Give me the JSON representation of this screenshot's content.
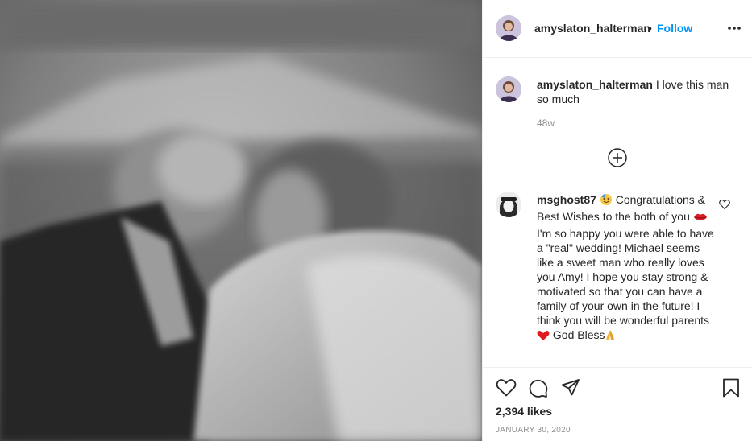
{
  "post": {
    "author": "amyslaton_halterman",
    "follow_label": "Follow",
    "separator": "•",
    "caption": {
      "username": "amyslaton_halterman",
      "text": "I love this man so much",
      "time": "48w"
    },
    "comment": {
      "username": "msghost87",
      "part1": "Congratulations & Best Wishes to the both of you",
      "part2": "I'm so happy you were able to have a \"real\" wedding! Michael seems like a sweet man who really loves you Amy! I hope you stay strong & motivated so that you can have a family of your own in the future! I think you will be wonderful parents",
      "part3": "God Bless"
    },
    "likes": "2,394 likes",
    "date": "JANUARY 30, 2020"
  },
  "icons": {
    "more": "more-options-icon",
    "load_more": "plus-circle-icon",
    "comment_like": "heart-icon",
    "like": "heart-icon",
    "comment": "comment-bubble-icon",
    "share": "paper-plane-icon",
    "save": "bookmark-icon"
  },
  "colors": {
    "link_blue": "#0095f6",
    "text": "#262626",
    "muted": "#8e8e8e",
    "border": "#efefef"
  }
}
